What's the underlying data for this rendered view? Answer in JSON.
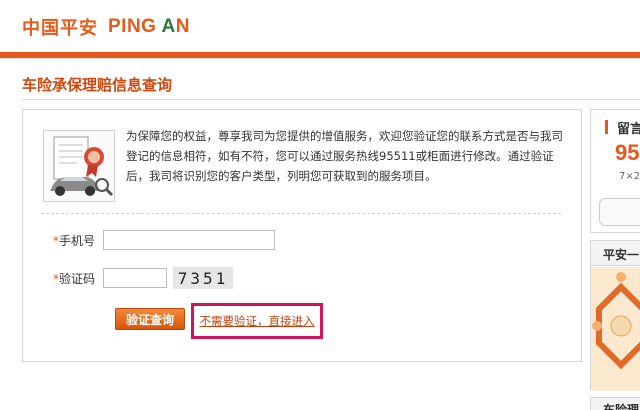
{
  "header": {
    "logo_cn": "中国平安",
    "logo_en_pre": "PING ",
    "logo_en_a": "A",
    "logo_en_post": "N"
  },
  "page": {
    "title": "车险承保理赔信息查询"
  },
  "intro": {
    "image_icon": "insurance-document-car-icon",
    "text": "为保障您的权益，尊享我司为您提供的增值服务，欢迎您验证您的联系方式是否与我司登记的信息相符，如有不符，您可以通过服务热线95511或柜面进行修改。通过验证后，我司将识别您的客户类型，列明您可获取到的服务项目。"
  },
  "form": {
    "required_mark": "*",
    "phone_label": "手机号",
    "phone_value": "",
    "code_label": "验证码",
    "code_value": "",
    "captcha_text": "7351",
    "verify_button": "验证查询",
    "skip_link": "不需要验证，直接进入"
  },
  "sidebar": {
    "box1_label": "留言",
    "box1_number": "95",
    "box1_hours": "7×2",
    "box2_title": "平安一",
    "box3_title": "车险理"
  },
  "colors": {
    "brand_orange": "#e8581a",
    "highlight_pink": "#d4145a"
  }
}
